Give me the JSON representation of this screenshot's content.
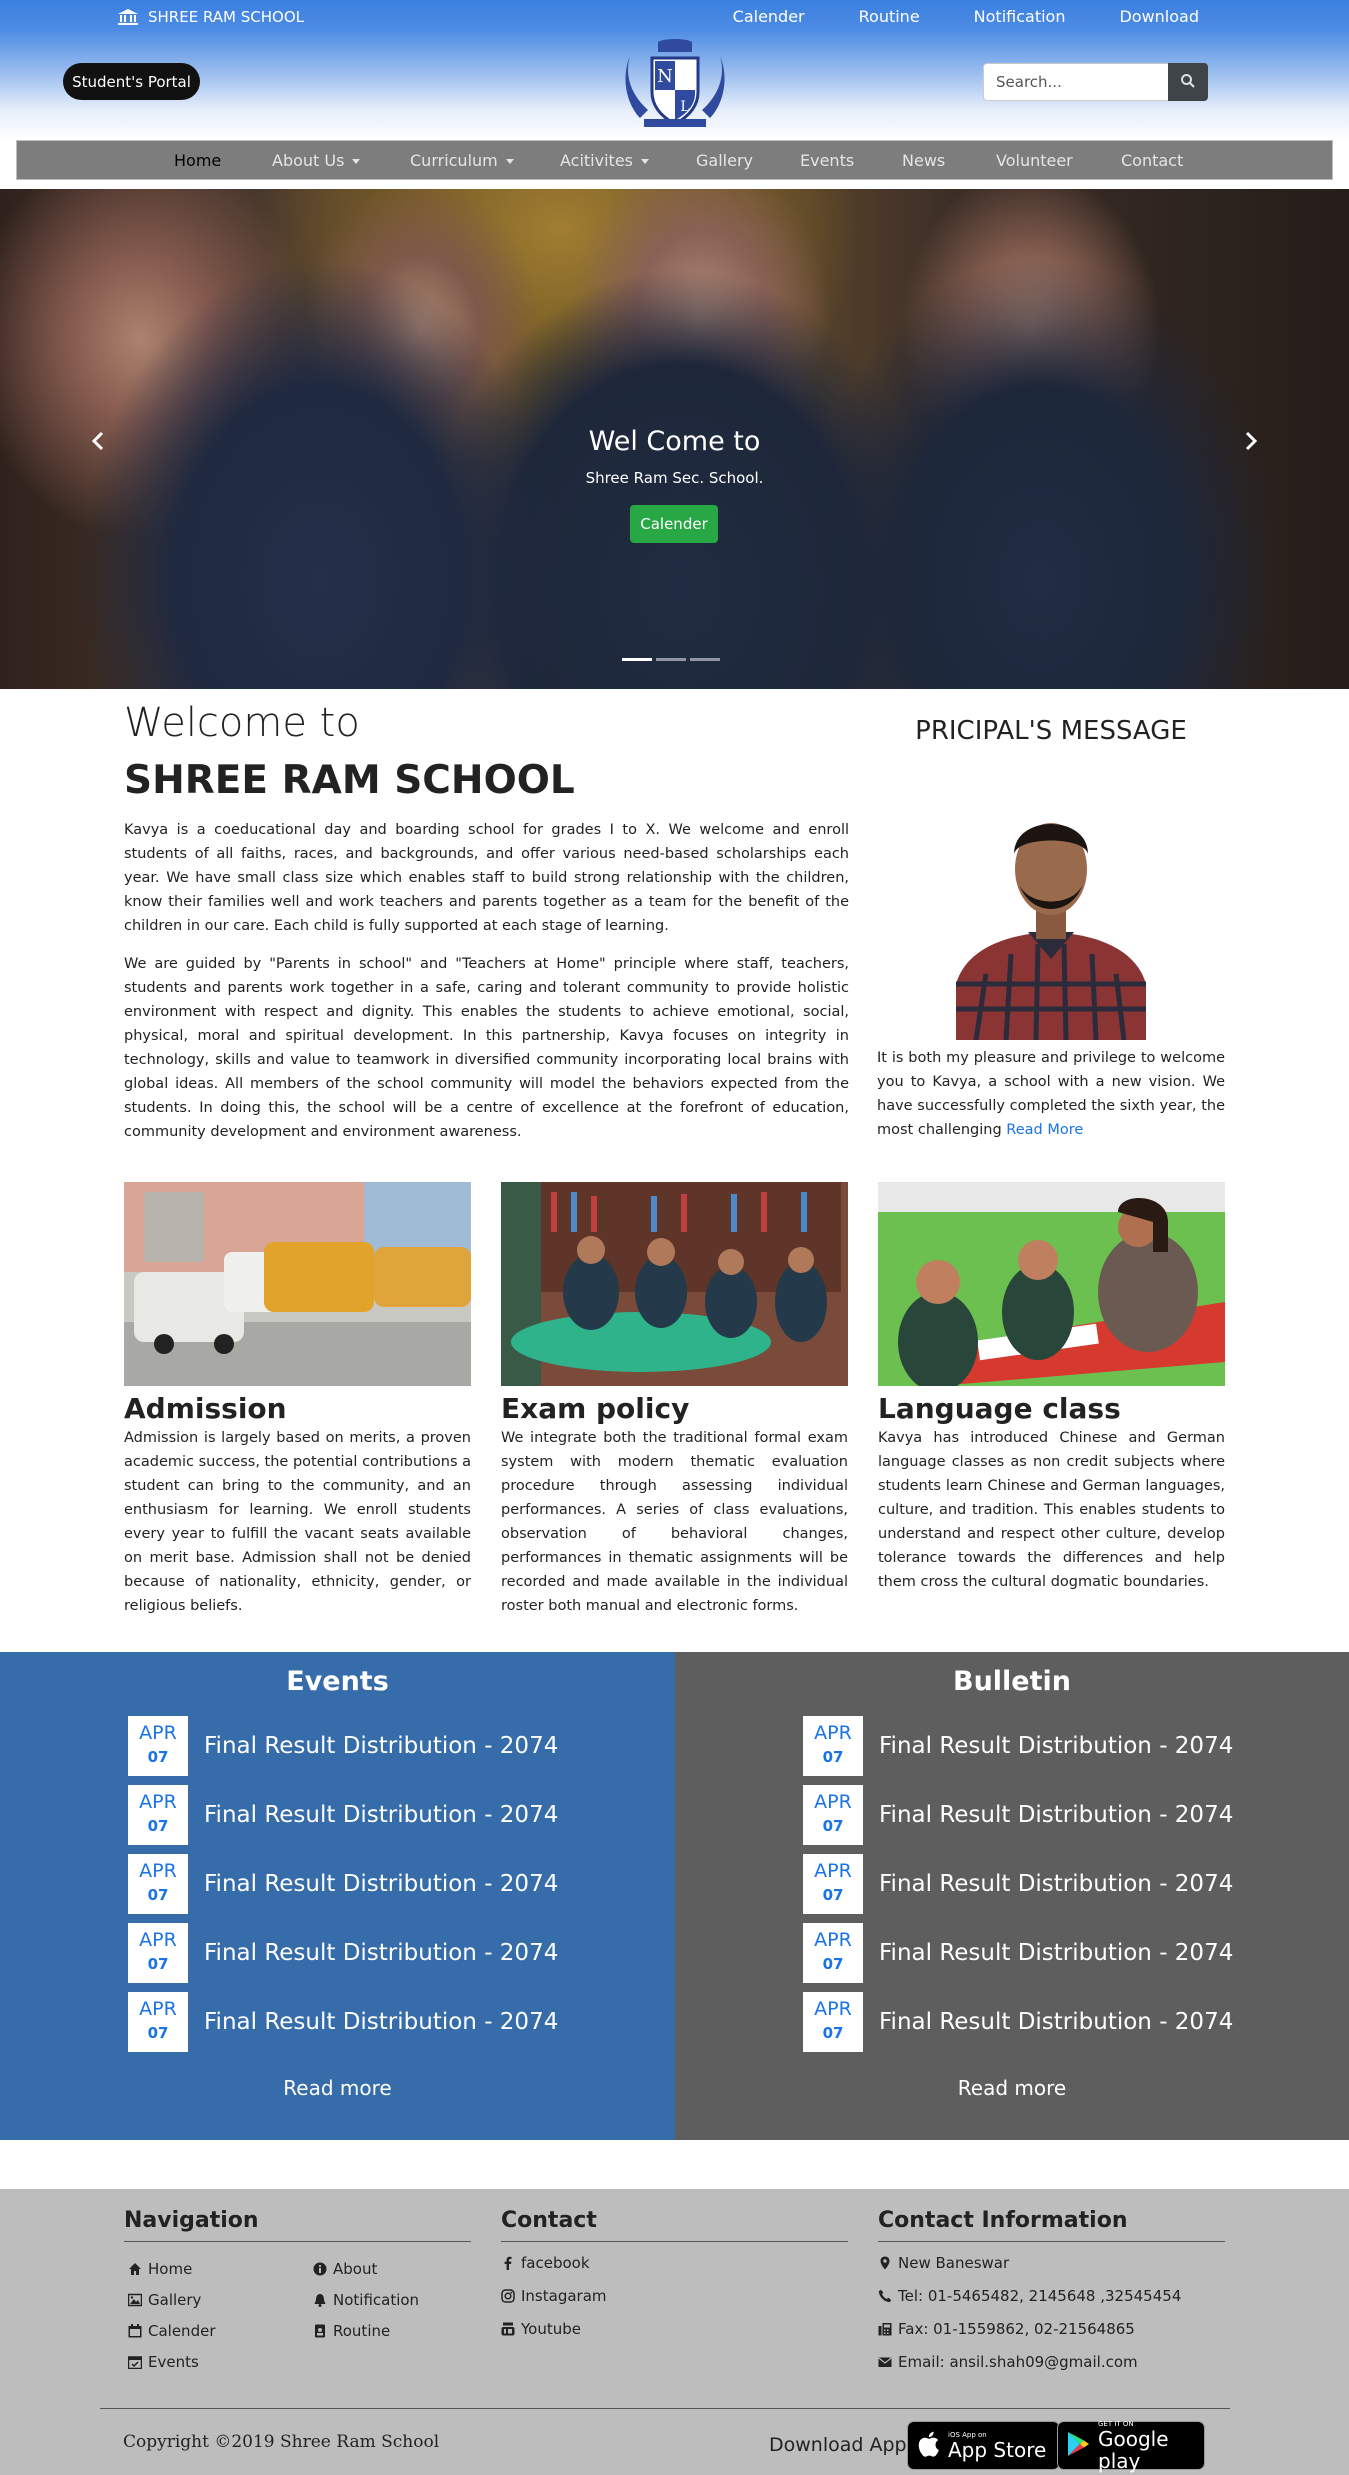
{
  "header": {
    "school_name": "SHREE RAM SCHOOL",
    "top_links": [
      "Calender",
      "Routine",
      "Notification",
      "Download"
    ],
    "portal_button": "Student's Portal",
    "search_placeholder": "Search..."
  },
  "nav": {
    "items": [
      "Home",
      "About Us",
      "Curriculum",
      "Acitivites",
      "Gallery",
      "Events",
      "News",
      "Volunteer",
      "Contact"
    ]
  },
  "hero": {
    "title": "Wel Come to",
    "subtitle": "Shree Ram Sec. School.",
    "button": "Calender"
  },
  "welcome": {
    "heading": "Welcome to",
    "school": "SHREE RAM SCHOOL",
    "p1": "Kavya is a coeducational day and boarding school for grades I to X. We welcome and enroll students of all faiths, races, and backgrounds, and offer various need-based scholarships each year. We have small class size which enables staff to build strong relationship with the children, know their families well and work teachers and parents together as a team for the benefit of the children in our care. Each child is fully supported at each stage of learning.",
    "p2": "We are guided by \"Parents in school\" and \"Teachers at Home\" principle where staff, teachers, students and parents work together in a safe, caring and tolerant community to provide holistic environment with respect and dignity. This enables the students to achieve emotional, social, physical, moral and spiritual development. In this partnership, Kavya focuses on integrity in technology, skills and value to teamwork in diversified community incorporating local brains with global ideas. All members of the school community will model the behaviors expected from the students. In doing this, the school will be a centre of excellence at the forefront of education, community development and environment awareness."
  },
  "principal": {
    "title": "PRICIPAL'S MESSAGE",
    "text": "It is both my pleasure and privilege to welcome you to Kavya, a school with a new vision. We have successfully completed the sixth year, the most challenging ",
    "read_more": "Read More"
  },
  "cards": [
    {
      "title": "Admission",
      "text": "Admission is largely based on merits, a proven academic success, the potential contributions a student can bring to the community, and an enthusiasm for learning. We enroll students every year to fulfill the vacant seats available on merit base. Admission shall not be denied because of nationality, ethnicity, gender, or religious beliefs."
    },
    {
      "title": "Exam policy",
      "text": "We integrate both the traditional formal exam system with modern thematic evaluation procedure through assessing individual performances. A series of class evaluations, observation of behavioral changes, performances in thematic assignments will be recorded and made available in the individual roster both manual and electronic forms."
    },
    {
      "title": "Language class",
      "text": "Kavya has introduced Chinese and German language classes as non credit subjects where students learn Chinese and German languages, culture, and tradition. This enables students to understand and respect other culture, develop tolerance towards the differences and help them cross the cultural dogmatic boundaries."
    }
  ],
  "events": {
    "title": "Events",
    "items": [
      {
        "month": "APR",
        "day": "07",
        "text": "Final Result Distribution - 2074"
      },
      {
        "month": "APR",
        "day": "07",
        "text": "Final Result Distribution - 2074"
      },
      {
        "month": "APR",
        "day": "07",
        "text": "Final Result Distribution - 2074"
      },
      {
        "month": "APR",
        "day": "07",
        "text": "Final Result Distribution - 2074"
      },
      {
        "month": "APR",
        "day": "07",
        "text": "Final Result Distribution - 2074"
      }
    ],
    "read_more": "Read more"
  },
  "bulletin": {
    "title": "Bulletin",
    "items": [
      {
        "month": "APR",
        "day": "07",
        "text": "Final Result Distribution - 2074"
      },
      {
        "month": "APR",
        "day": "07",
        "text": "Final Result Distribution - 2074"
      },
      {
        "month": "APR",
        "day": "07",
        "text": "Final Result Distribution - 2074"
      },
      {
        "month": "APR",
        "day": "07",
        "text": "Final Result Distribution - 2074"
      },
      {
        "month": "APR",
        "day": "07",
        "text": "Final Result Distribution - 2074"
      }
    ],
    "read_more": "Read more"
  },
  "footer": {
    "nav_title": "Navigation",
    "nav_items": [
      {
        "label": "Home",
        "icon": "home-icon"
      },
      {
        "label": "About",
        "icon": "info-icon"
      },
      {
        "label": "Gallery",
        "icon": "image-icon"
      },
      {
        "label": "Notification",
        "icon": "bell-icon"
      },
      {
        "label": "Calender",
        "icon": "calendar-icon"
      },
      {
        "label": "Routine",
        "icon": "id-badge-icon"
      },
      {
        "label": "Events",
        "icon": "calendar-check-icon"
      }
    ],
    "contact_title": "Contact",
    "contact_items": [
      {
        "label": "facebook",
        "icon": "facebook-icon"
      },
      {
        "label": "Instagaram",
        "icon": "instagram-icon"
      },
      {
        "label": "Youtube",
        "icon": "youtube-icon"
      }
    ],
    "info_title": "Contact Information",
    "info_items": [
      {
        "label": "New Baneswar",
        "icon": "map-marker-icon"
      },
      {
        "label": "Tel: 01-5465482, 2145648 ,32545454",
        "icon": "phone-icon"
      },
      {
        "label": "Fax: 01-1559862, 02-21564865",
        "icon": "fax-icon"
      },
      {
        "label": "Email: ansil.shah09@gmail.com",
        "icon": "envelope-icon"
      }
    ],
    "copyright": "Copyright ©2019 Shree Ram School",
    "download_label": "Download App",
    "appstore_small": "iOS App on",
    "appstore_big": "App Store",
    "gplay_small": "GET IT ON",
    "gplay_big": "Google play"
  },
  "colors": {
    "header_blue": "#3b7fe0",
    "events_blue": "#366ca9",
    "bulletin_gray": "#5e5e5e",
    "footer_gray": "#bdbdbd",
    "hero_button_green": "#28a745",
    "date_text_blue": "#1a73e8"
  }
}
